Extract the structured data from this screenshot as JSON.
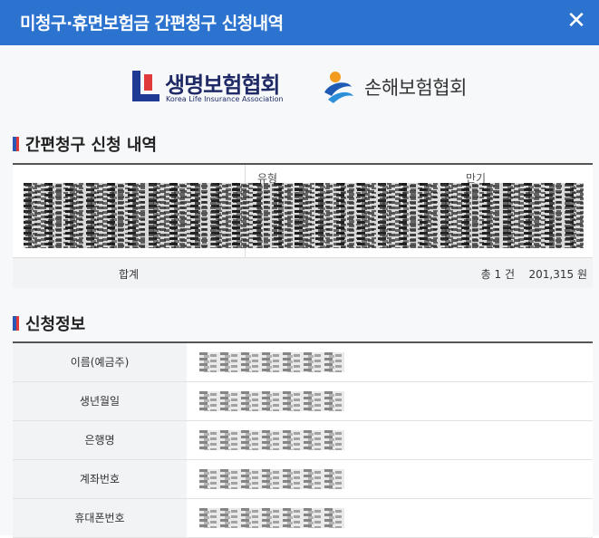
{
  "window": {
    "title": "미청구·휴면보험금 간편청구 신청내역",
    "close_label": "✕"
  },
  "logos": {
    "life": {
      "name": "생명보험협회",
      "sub": "Korea Life Insurance Association"
    },
    "nonlife": {
      "name": "손해보험협회"
    }
  },
  "claims": {
    "section_title": "간편청구 신청 내역",
    "columns": [
      "유형",
      "만기"
    ],
    "summary": {
      "label": "합계",
      "count": "총 1 건",
      "amount": "201,315 원"
    }
  },
  "applicant": {
    "section_title": "신청정보",
    "rows": [
      {
        "label": "이름(예금주)"
      },
      {
        "label": "생년월일"
      },
      {
        "label": "은행명"
      },
      {
        "label": "계좌번호"
      },
      {
        "label": "휴대폰번호"
      }
    ]
  },
  "colors": {
    "header": "#2b73cf",
    "brand_navy": "#1f3a93",
    "brand_red": "#e03a3a"
  }
}
